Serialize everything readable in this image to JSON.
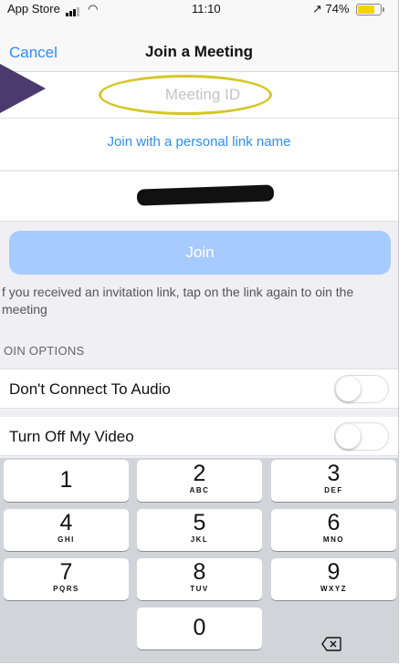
{
  "status_bar": {
    "carrier": "App Store",
    "time": "11:10",
    "battery": "74%"
  },
  "nav": {
    "cancel_label": "Cancel",
    "title": "Join a Meeting"
  },
  "meeting_id": {
    "placeholder": "Meeting ID",
    "value": ""
  },
  "personal_link_label": "Join with a personal link name",
  "join_button_label": "Join",
  "invite_note": "f you received an invitation link, tap on the link again to oin the meeting",
  "section_title": "OIN OPTIONS",
  "options": [
    {
      "label": "Don't Connect To Audio",
      "enabled": false
    },
    {
      "label": "Turn Off My Video",
      "enabled": false
    }
  ],
  "keypad": {
    "keys": [
      {
        "num": "1",
        "letters": ""
      },
      {
        "num": "2",
        "letters": "ABC"
      },
      {
        "num": "3",
        "letters": "DEF"
      },
      {
        "num": "4",
        "letters": "GHI"
      },
      {
        "num": "5",
        "letters": "JKL"
      },
      {
        "num": "6",
        "letters": "MNO"
      },
      {
        "num": "7",
        "letters": "PQRS"
      },
      {
        "num": "8",
        "letters": "TUV"
      },
      {
        "num": "9",
        "letters": "WXYZ"
      },
      {
        "num": "0",
        "letters": ""
      }
    ],
    "delete_icon": "backspace-icon"
  },
  "colors": {
    "accent": "#2d8cff",
    "join_button": "#a8cbff",
    "highlight": "#d4c728"
  }
}
